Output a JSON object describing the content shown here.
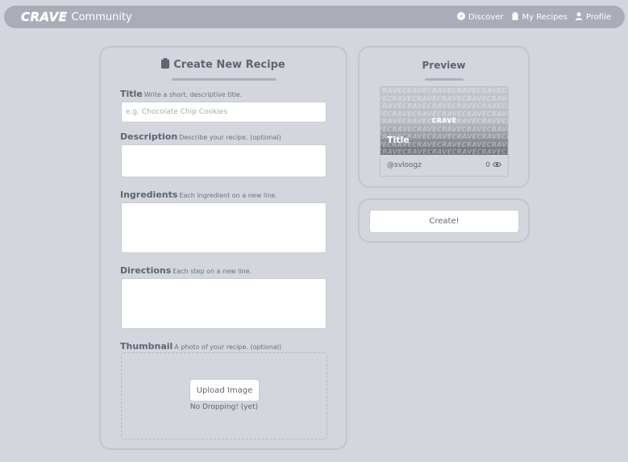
{
  "nav": {
    "brand_logo": "CRAVE",
    "brand_text": "Community",
    "links": [
      {
        "label": "Discover",
        "icon": "compass-icon"
      },
      {
        "label": "My Recipes",
        "icon": "clipboard-icon"
      },
      {
        "label": "Profile",
        "icon": "user-icon"
      }
    ]
  },
  "form": {
    "heading": "Create New Recipe",
    "title": {
      "label": "Title",
      "hint": "Write a short, descriptive title.",
      "placeholder": "e.g. Chocolate Chip Cookies",
      "value": ""
    },
    "description": {
      "label": "Description",
      "hint": "Describe your recipe. (optional)",
      "value": ""
    },
    "ingredients": {
      "label": "Ingredients",
      "hint": "Each ingredient on a new line.",
      "value": ""
    },
    "directions": {
      "label": "Directions",
      "hint": "Each step on a new line.",
      "value": ""
    },
    "thumbnail": {
      "label": "Thumbnail",
      "hint": "A photo of your recipe. (optional)",
      "upload_label": "Upload Image",
      "drop_note": "No Dropping! (yet)"
    }
  },
  "preview": {
    "heading": "Preview",
    "card": {
      "thumb_pattern_word": "CRAVE",
      "thumb_logo": "CRAVE",
      "title": "Title",
      "author": "@svloogz",
      "views": "0"
    }
  },
  "actions": {
    "create_label": "Create!"
  },
  "colors": {
    "background": "#d3d6dd",
    "navbar": "#a9adb8",
    "text": "#5f6472",
    "panel_border": "#c2c5cd"
  }
}
